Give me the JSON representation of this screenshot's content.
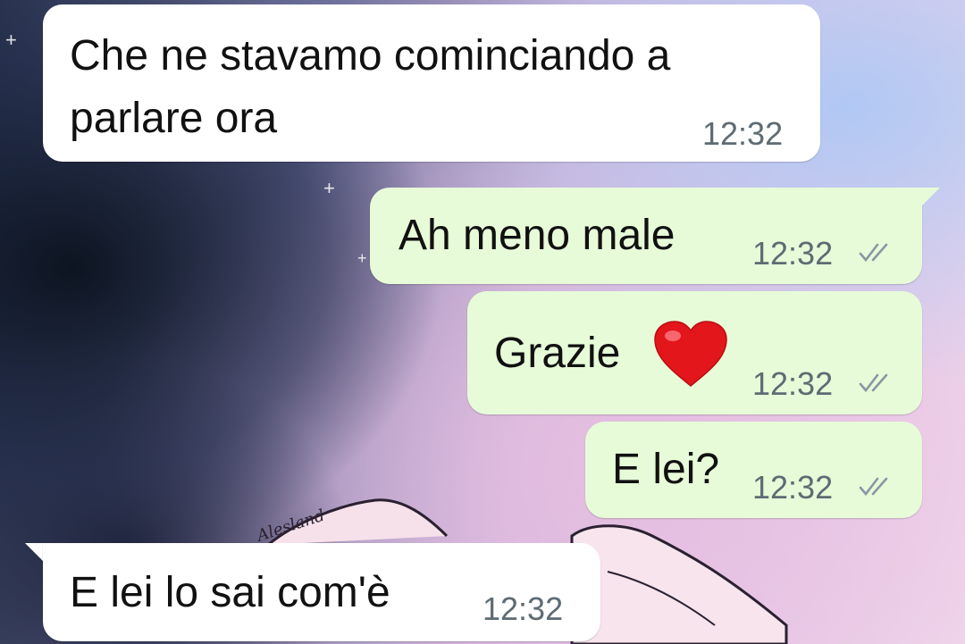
{
  "messages": [
    {
      "direction": "incoming",
      "line1": "Che ne stavamo cominciando a",
      "line2": "parlare ora",
      "time": "12:32"
    },
    {
      "direction": "outgoing",
      "text": "Ah meno male",
      "time": "12:32",
      "status": "delivered"
    },
    {
      "direction": "outgoing",
      "text": "Grazie",
      "emoji": "❤️",
      "time": "12:32",
      "status": "delivered"
    },
    {
      "direction": "outgoing",
      "text": "E lei?",
      "time": "12:32",
      "status": "delivered"
    },
    {
      "direction": "incoming",
      "text": "E lei lo sai com'è",
      "time": "12:32"
    }
  ],
  "background": {
    "watermark": "Alesland",
    "colors": {
      "dark": "#1b2438",
      "pink": "#e6c9e6",
      "blue": "#b9cdf2"
    }
  },
  "colors": {
    "incoming_bubble": "#ffffff",
    "outgoing_bubble": "#e7fbd8",
    "text": "#111111",
    "time": "#5f6b73",
    "tick": "#8a97a3"
  },
  "icons": {
    "status": "double-check-icon",
    "emoji": "red-heart-icon"
  }
}
